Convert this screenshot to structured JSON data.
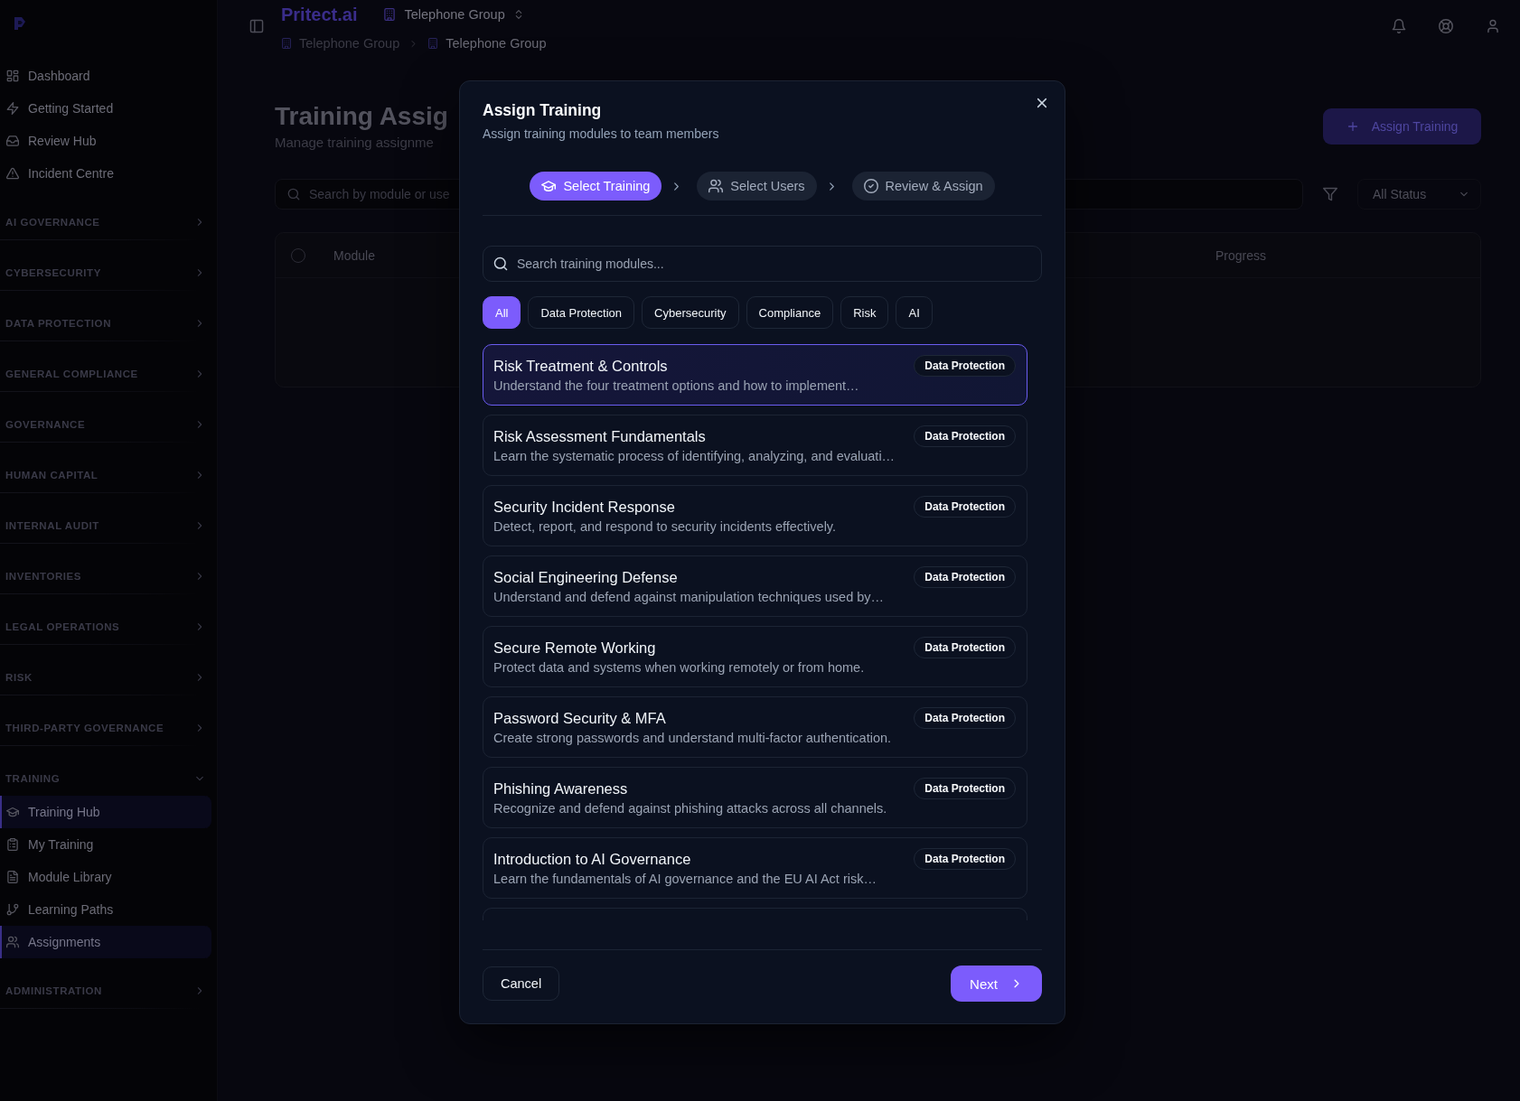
{
  "sidebar": {
    "nav": [
      {
        "label": "Dashboard",
        "selected": false
      },
      {
        "label": "Getting Started",
        "selected": false
      },
      {
        "label": "Review Hub",
        "selected": false
      },
      {
        "label": "Incident Centre",
        "selected": false
      }
    ],
    "sections": [
      {
        "label": "AI GOVERNANCE",
        "expanded": false
      },
      {
        "label": "CYBERSECURITY",
        "expanded": false
      },
      {
        "label": "DATA PROTECTION",
        "expanded": false
      },
      {
        "label": "GENERAL COMPLIANCE",
        "expanded": false
      },
      {
        "label": "GOVERNANCE",
        "expanded": false
      },
      {
        "label": "HUMAN CAPITAL",
        "expanded": false
      },
      {
        "label": "INTERNAL AUDIT",
        "expanded": false
      },
      {
        "label": "INVENTORIES",
        "expanded": false
      },
      {
        "label": "LEGAL OPERATIONS",
        "expanded": false
      },
      {
        "label": "RISK",
        "expanded": false
      },
      {
        "label": "THIRD-PARTY GOVERNANCE",
        "expanded": false
      },
      {
        "label": "TRAINING",
        "expanded": true,
        "children": [
          {
            "label": "Training Hub",
            "selected": true
          },
          {
            "label": "My Training",
            "selected": false
          },
          {
            "label": "Module Library",
            "selected": false
          },
          {
            "label": "Learning Paths",
            "selected": false
          },
          {
            "label": "Assignments",
            "selected": true
          }
        ]
      },
      {
        "label": "ADMINISTRATION",
        "expanded": false
      }
    ]
  },
  "top_bar": {
    "brand": "Pritect.ai",
    "workspace": "Telephone Group",
    "breadcrumb": [
      "Telephone Group",
      "Telephone Group"
    ]
  },
  "page": {
    "title": "Training Assig",
    "subtitle": "Manage training assignme",
    "assign_button": "Assign Training",
    "search": {
      "placeholder": "Search by module or use"
    },
    "status_filter": "All Status",
    "table": {
      "select_all": {
        "checked": false
      },
      "columns": [
        "Module",
        "Progress"
      ]
    }
  },
  "modal": {
    "title": "Assign Training",
    "subtitle": "Assign training modules to team members",
    "steps": [
      {
        "label": "Select Training",
        "selected": true
      },
      {
        "label": "Select Users",
        "selected": false
      },
      {
        "label": "Review & Assign",
        "selected": false
      }
    ],
    "search": {
      "placeholder": "Search training modules..."
    },
    "filters": [
      {
        "label": "All",
        "selected": true
      },
      {
        "label": "Data Protection",
        "selected": false
      },
      {
        "label": "Cybersecurity",
        "selected": false
      },
      {
        "label": "Compliance",
        "selected": false
      },
      {
        "label": "Risk",
        "selected": false
      },
      {
        "label": "AI",
        "selected": false
      }
    ],
    "modules": [
      {
        "title": "Risk Treatment & Controls",
        "description": "Understand the four treatment options and how to implement…",
        "tag": "Data Protection",
        "selected": true
      },
      {
        "title": "Risk Assessment Fundamentals",
        "description": "Learn the systematic process of identifying, analyzing, and evaluati…",
        "tag": "Data Protection",
        "selected": false
      },
      {
        "title": "Security Incident Response",
        "description": "Detect, report, and respond to security incidents effectively.",
        "tag": "Data Protection",
        "selected": false
      },
      {
        "title": "Social Engineering Defense",
        "description": "Understand and defend against manipulation techniques used by…",
        "tag": "Data Protection",
        "selected": false
      },
      {
        "title": "Secure Remote Working",
        "description": "Protect data and systems when working remotely or from home.",
        "tag": "Data Protection",
        "selected": false
      },
      {
        "title": "Password Security & MFA",
        "description": "Create strong passwords and understand multi-factor authentication.",
        "tag": "Data Protection",
        "selected": false
      },
      {
        "title": "Phishing Awareness",
        "description": "Recognize and defend against phishing attacks across all channels.",
        "tag": "Data Protection",
        "selected": false
      },
      {
        "title": "Introduction to AI Governance",
        "description": "Learn the fundamentals of AI governance and the EU AI Act risk…",
        "tag": "Data Protection",
        "selected": false
      }
    ],
    "cancel_button": "Cancel",
    "next_button": "Next"
  }
}
